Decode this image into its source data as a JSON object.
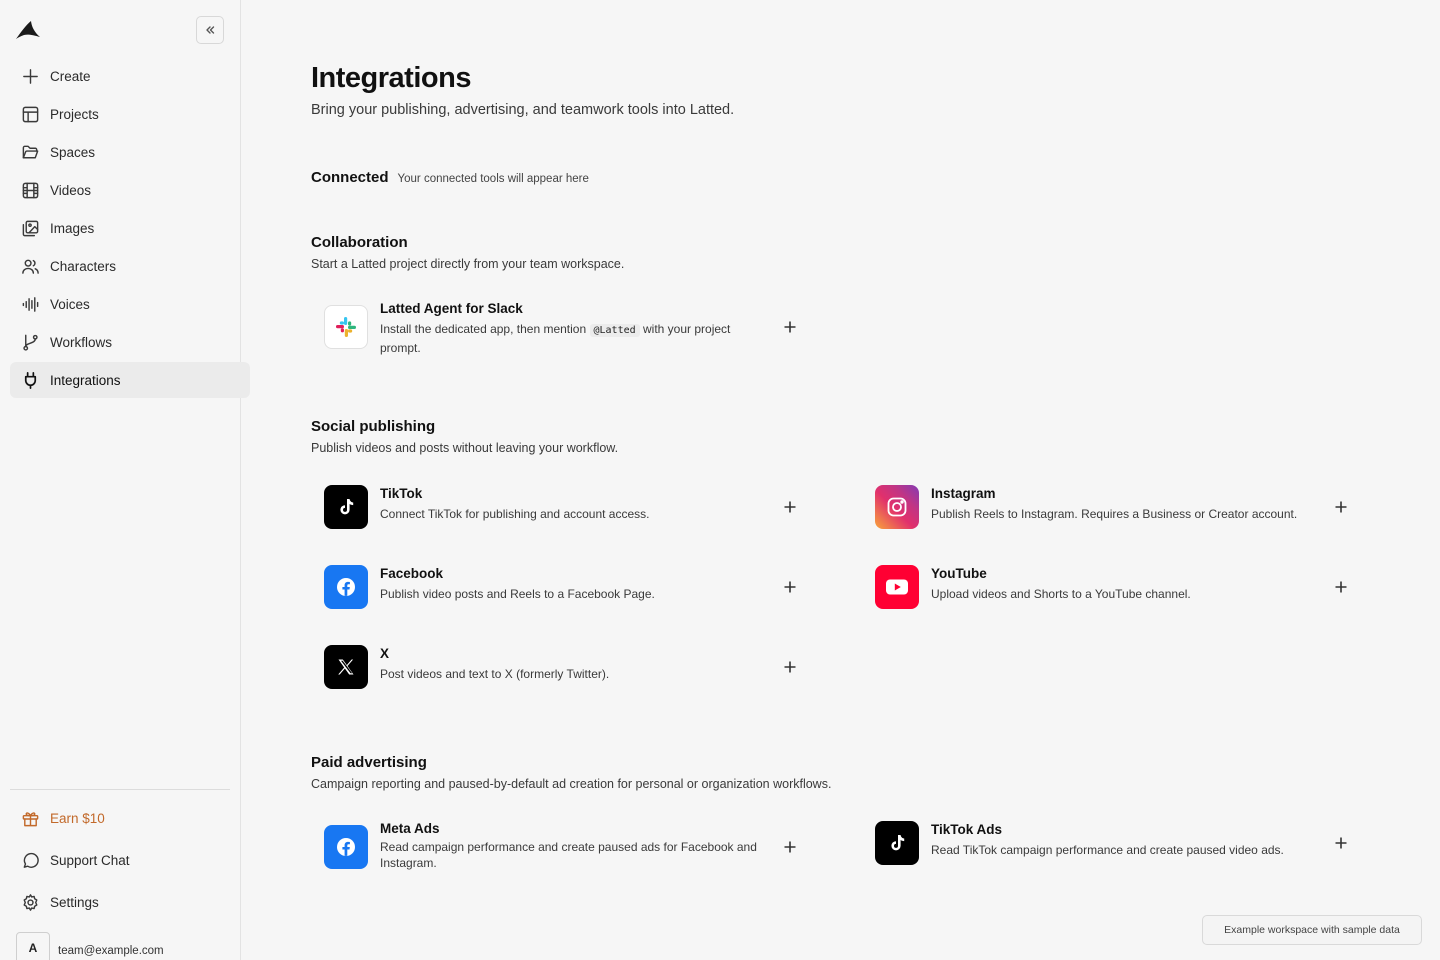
{
  "sidebar": {
    "items": [
      {
        "label": "Create",
        "icon": "plus-icon"
      },
      {
        "label": "Projects",
        "icon": "layout-icon"
      },
      {
        "label": "Spaces",
        "icon": "folder-open-icon"
      },
      {
        "label": "Videos",
        "icon": "film-icon"
      },
      {
        "label": "Images",
        "icon": "images-icon"
      },
      {
        "label": "Characters",
        "icon": "users-icon"
      },
      {
        "label": "Voices",
        "icon": "audio-waveform-icon"
      },
      {
        "label": "Workflows",
        "icon": "git-branch-icon"
      },
      {
        "label": "Integrations",
        "icon": "plug-icon",
        "active": true
      }
    ],
    "bottom": {
      "earn": "Earn $10",
      "support": "Support Chat",
      "settings": "Settings"
    },
    "user": {
      "initial": "A",
      "email": "team@example.com"
    }
  },
  "page": {
    "title": "Integrations",
    "subtitle": "Bring your publishing, advertising, and teamwork tools into Latted."
  },
  "connected": {
    "title": "Connected",
    "hint": "Your connected tools will appear here"
  },
  "collaboration": {
    "title": "Collaboration",
    "subtitle": "Start a Latted project directly from your team workspace.",
    "slack": {
      "name": "Latted Agent for Slack",
      "desc_before": "Install the dedicated app, then mention",
      "mention": "@Latted",
      "desc_after": "with your project prompt."
    }
  },
  "social": {
    "title": "Social publishing",
    "subtitle": "Publish videos and posts without leaving your workflow.",
    "tiktok": {
      "name": "TikTok",
      "desc": "Connect TikTok for publishing and account access."
    },
    "instagram": {
      "name": "Instagram",
      "desc": "Publish Reels to Instagram. Requires a Business or Creator account."
    },
    "facebook": {
      "name": "Facebook",
      "desc": "Publish video posts and Reels to a Facebook Page."
    },
    "youtube": {
      "name": "YouTube",
      "desc": "Upload videos and Shorts to a YouTube channel."
    },
    "x": {
      "name": "X",
      "desc": "Post videos and text to X (formerly Twitter)."
    }
  },
  "ads": {
    "title": "Paid advertising",
    "subtitle": "Campaign reporting and paused-by-default ad creation for personal or organization workflows.",
    "meta": {
      "name": "Meta Ads",
      "desc": "Read campaign performance and create paused ads for Facebook and Instagram."
    },
    "tiktok_ads": {
      "name": "TikTok Ads",
      "desc": "Read TikTok campaign performance and create paused video ads."
    }
  },
  "footer": {
    "badge": "Example workspace with sample data"
  },
  "colors": {
    "tiktok": "#000000",
    "facebook": "#1877f2",
    "youtube": "#ff0033",
    "x": "#000000",
    "earn": "#c2692a"
  }
}
